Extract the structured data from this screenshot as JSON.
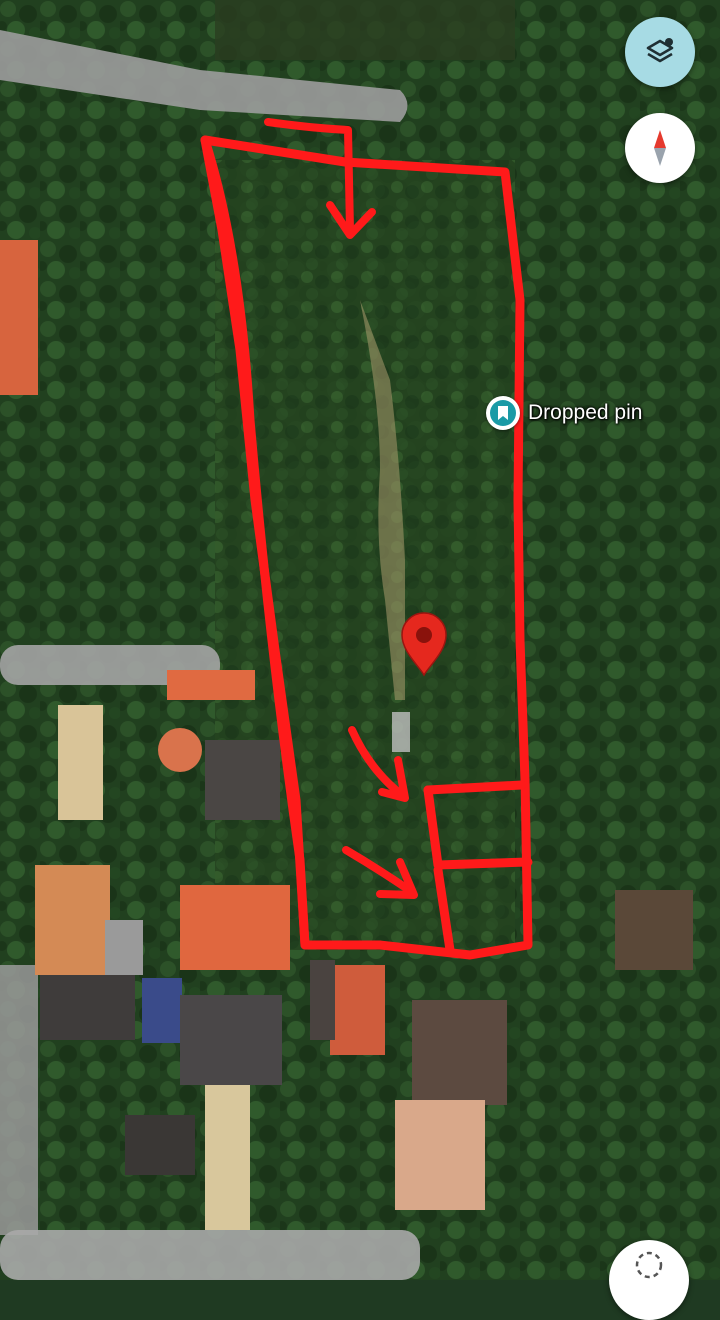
{
  "map": {
    "dropped_pin_label": "Dropped pin",
    "pin_color": "#e5281e",
    "annotation_color": "#ff1a1a",
    "accent_teal": "#1a9aa6"
  },
  "controls": {
    "layers_icon": "layers-icon",
    "compass_icon": "compass-icon",
    "location_icon": "my-location-icon"
  }
}
